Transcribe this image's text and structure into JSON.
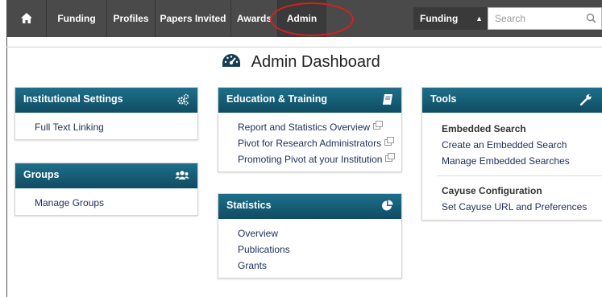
{
  "nav": {
    "home_icon": "home-icon",
    "items": [
      "Funding",
      "Profiles",
      "Papers Invited",
      "Awards",
      "Admin"
    ],
    "search_scope": "Funding",
    "search_placeholder": "Search"
  },
  "page": {
    "title": "Admin Dashboard",
    "title_icon": "dashboard-gauge-icon"
  },
  "panels": {
    "institutional": {
      "title": "Institutional Settings",
      "icon": "gears-icon",
      "links": [
        "Full Text Linking"
      ]
    },
    "groups": {
      "title": "Groups",
      "icon": "users-icon",
      "links": [
        "Manage Groups"
      ]
    },
    "education": {
      "title": "Education & Training",
      "icon": "book-icon",
      "links": [
        "Report and Statistics Overview",
        "Pivot for Research Administrators",
        "Promoting Pivot at your Institution"
      ]
    },
    "statistics": {
      "title": "Statistics",
      "icon": "pie-chart-icon",
      "links": [
        "Overview",
        "Publications",
        "Grants"
      ]
    },
    "tools": {
      "title": "Tools",
      "icon": "wrench-icon",
      "embedded_heading": "Embedded Search",
      "embedded_links": [
        "Create an Embedded Search",
        "Manage Embedded Searches"
      ],
      "cayuse_heading": "Cayuse Configuration",
      "cayuse_links": [
        "Set Cayuse URL and Preferences"
      ]
    }
  },
  "colors": {
    "nav_bg": "#4a4a4a",
    "panel_header": "#155a72",
    "highlight_circle": "#d6201c",
    "link": "#1f2d5c"
  }
}
